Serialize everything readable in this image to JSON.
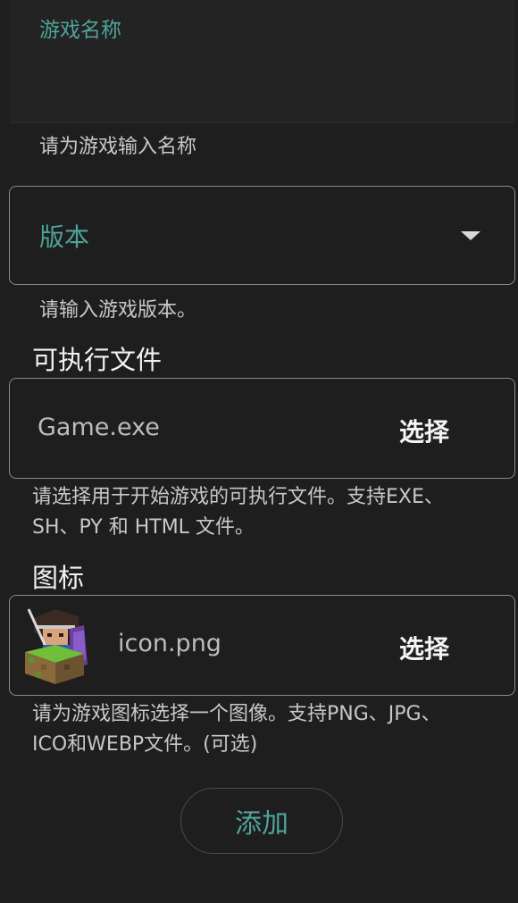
{
  "form": {
    "name": {
      "label": "游戏名称",
      "value": "",
      "helper": "请为游戏输入名称"
    },
    "version": {
      "label": "版本",
      "helper": "请输入游戏版本。"
    },
    "executable": {
      "title": "可执行文件",
      "value": "Game.exe",
      "button": "选择",
      "helper_line1": "请选择用于开始游戏的可执行文件。支持EXE、",
      "helper_line2": "SH、PY 和 HTML 文件。"
    },
    "icon": {
      "title": "图标",
      "value": "icon.png",
      "button": "选择",
      "helper_line1": "请为游戏图标选择一个图像。支持PNG、JPG、",
      "helper_line2": "ICO和WEBP文件。(可选)"
    },
    "submit": "添加"
  },
  "colors": {
    "accent": "#4fa39a",
    "background": "#1e1e1e",
    "outline": "#8a8a8a"
  }
}
